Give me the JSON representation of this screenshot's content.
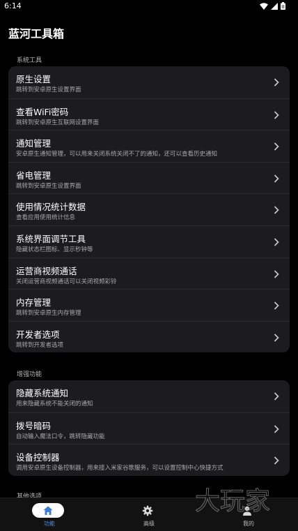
{
  "status": {
    "time": "6:14"
  },
  "app": {
    "title": "蓝河工具箱"
  },
  "sections": [
    {
      "header": "系统工具",
      "items": [
        {
          "title": "原生设置",
          "subtitle": "跳转到安卓原生设置界面"
        },
        {
          "title": "查看WiFi密码",
          "subtitle": "跳转到安卓原生互联网设置界面"
        },
        {
          "title": "通知管理",
          "subtitle": "安卓原生通知管理，可以用来关闭系统关闭不了的通知，还可以查看历史通知"
        },
        {
          "title": "省电管理",
          "subtitle": "跳转到安卓原生设置界面"
        },
        {
          "title": "使用情况统计数据",
          "subtitle": "查看应用使用统计信息"
        },
        {
          "title": "系统界面调节工具",
          "subtitle": "隐藏状态栏图标、显示秒钟等"
        },
        {
          "title": "运营商视频通话",
          "subtitle": "关闭运营商视频通话可以关闭视频彩铃"
        },
        {
          "title": "内存管理",
          "subtitle": "跳转到安卓原生内存管理"
        },
        {
          "title": "开发者选项",
          "subtitle": "跳转到开发者选项"
        }
      ]
    },
    {
      "header": "增强功能",
      "items": [
        {
          "title": "隐藏系统通知",
          "subtitle": "用来隐藏系统不能关闭的通知"
        },
        {
          "title": "拨号暗码",
          "subtitle": "自动输入魔法口令，跳转隐藏功能"
        },
        {
          "title": "设备控制器",
          "subtitle": "调用安卓原生设备控制器，用来接入米家谷歌服务，可以设置控制中心快捷方式"
        }
      ]
    },
    {
      "header": "其他选项",
      "items": []
    }
  ],
  "nav": [
    {
      "label": "功能",
      "icon": "home-icon",
      "active": true
    },
    {
      "label": "高级",
      "icon": "gear-icon",
      "active": false
    },
    {
      "label": "我的",
      "icon": "person-icon",
      "active": false
    }
  ],
  "watermark": "大玩家",
  "colors": {
    "background": "#000000",
    "card": "#1c1c1e",
    "accent": "#4a90e2",
    "subtitle": "#a9a9a9"
  }
}
